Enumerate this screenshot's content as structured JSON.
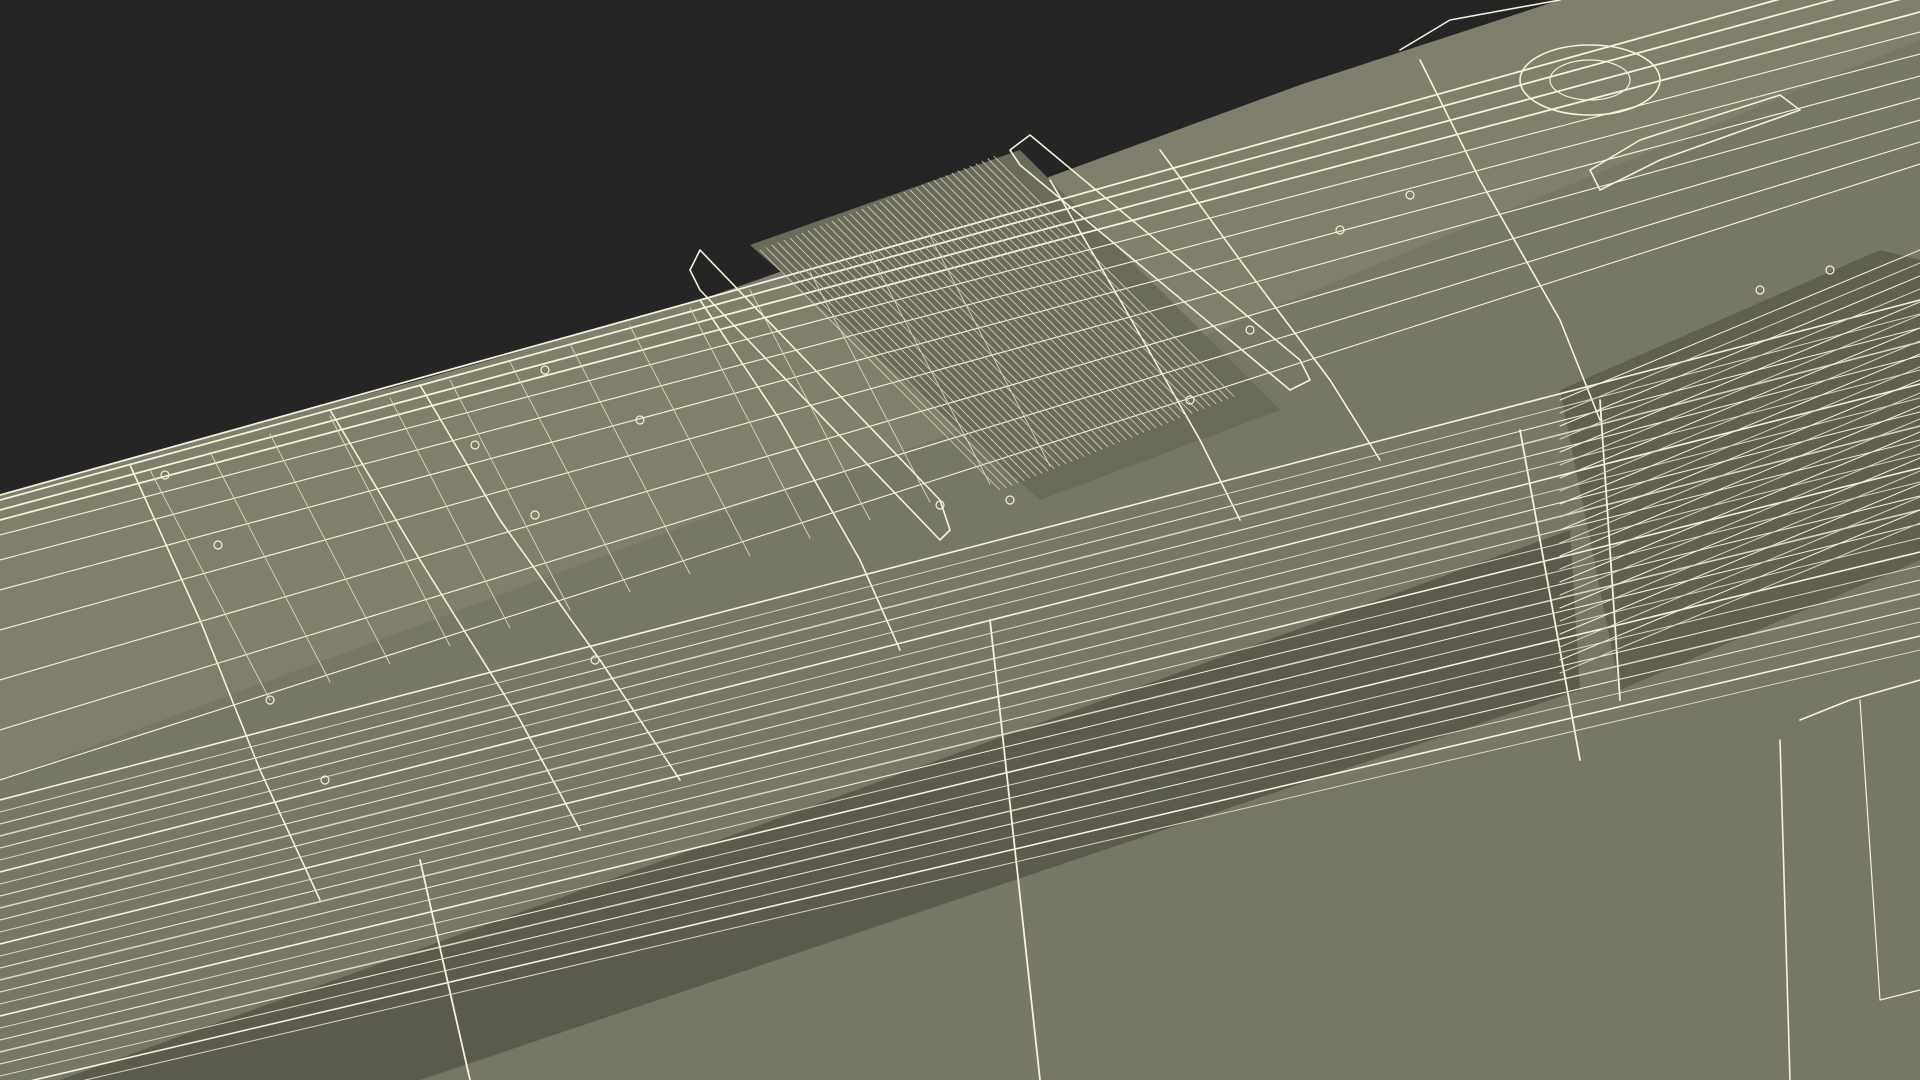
{
  "scene": {
    "subject": "",
    "render_style": "wireframe",
    "colors": {
      "background": "#252525",
      "surface": "#7a7a68",
      "surface_light": "#85856f",
      "surface_dark": "#5e5e50",
      "shadow": "#3d3d35",
      "wire": "#f4f1dc",
      "wire_dim": "#d8d5bf"
    }
  }
}
